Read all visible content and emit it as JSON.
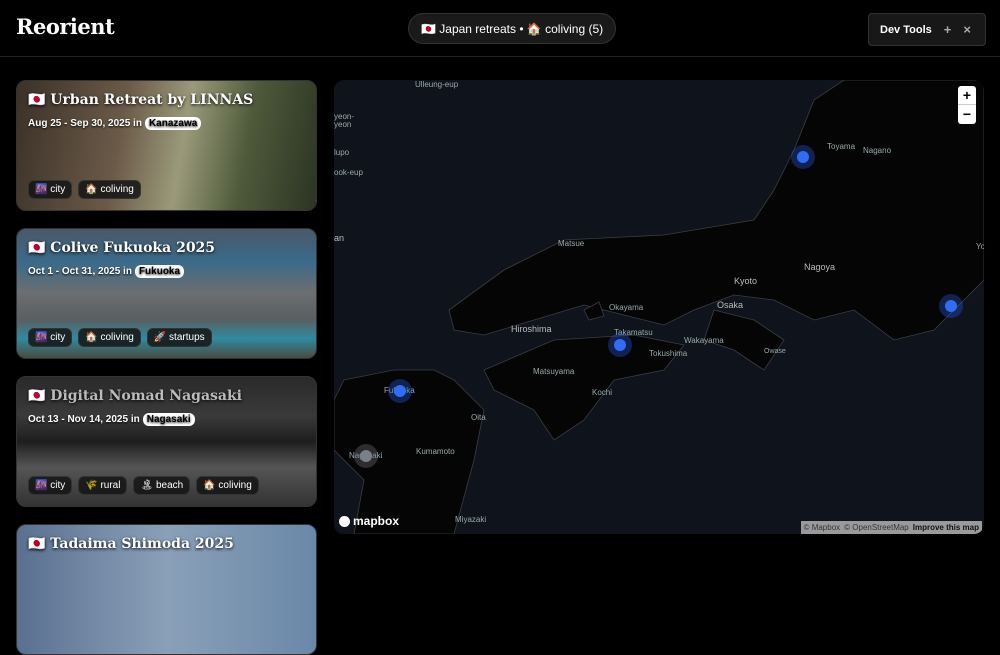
{
  "header": {
    "logo": "Reorient",
    "filter_pill": "🇯🇵 Japan retreats • 🏠 coliving (5)",
    "devtools": {
      "label": "Dev Tools",
      "add": "+",
      "close": "×"
    }
  },
  "retreats": [
    {
      "title": "🇯🇵 Urban Retreat by LINNAS",
      "dates": "Aug 25 - Sep 30, 2025 in",
      "city": "Kanazawa",
      "tags": [
        "🌆 city",
        "🏠 coliving"
      ]
    },
    {
      "title": "🇯🇵 Colive Fukuoka 2025",
      "dates": "Oct 1 - Oct 31, 2025 in",
      "city": "Fukuoka",
      "tags": [
        "🌆 city",
        "🏠 coliving",
        "🚀 startups"
      ]
    },
    {
      "title": "🇯🇵 Digital Nomad Nagasaki",
      "dates": "Oct 13 - Nov 14, 2025 in",
      "city": "Nagasaki",
      "tags": [
        "🌆 city",
        "🌾 rural",
        "🏝 beach",
        "🏠 coliving"
      ]
    },
    {
      "title": "🇯🇵 Tadaima Shimoda 2025"
    }
  ],
  "map": {
    "labels": [
      "Ulleung-eup",
      "yeon-",
      "yeon",
      "lupo",
      "ook-eup",
      "an",
      "Toyama",
      "Nagano",
      "Matsue",
      "Kyoto",
      "Nagoya",
      "Yo",
      "Okayama",
      "Osaka",
      "Hiroshima",
      "Takamatsu",
      "Wakayama",
      "Tokushima",
      "Owase",
      "Matsuyama",
      "Kochi",
      "Fukuoka",
      "Oita",
      "Nagasaki",
      "Kumamoto",
      "Miyazaki"
    ],
    "zoom_in": "+",
    "zoom_out": "−",
    "brand": "mapbox",
    "attribution": [
      "© Mapbox",
      "© OpenStreetMap",
      "Improve this map"
    ],
    "marker_color": "#2f6df5"
  }
}
